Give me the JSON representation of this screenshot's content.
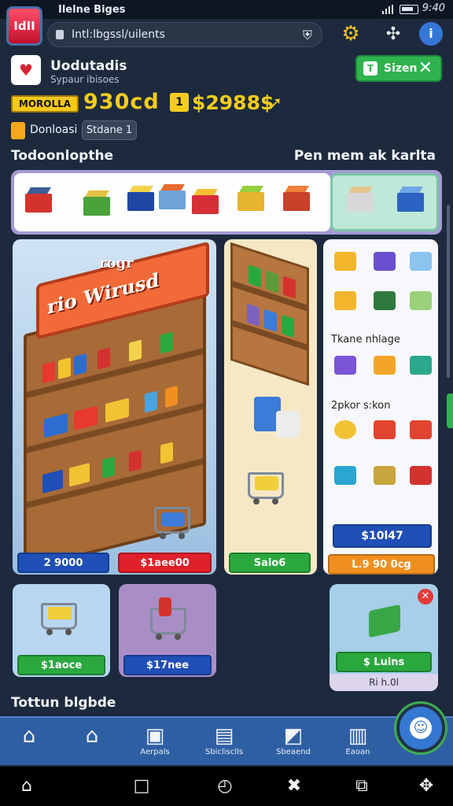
{
  "status": {
    "title": "Ilelne Biges",
    "time": "9:40"
  },
  "browser": {
    "url": "Intl:lbgssl/uilents"
  },
  "profile": {
    "name": "Uodutadis",
    "subtitle": "Sypaur ibisoes"
  },
  "header": {
    "action_label": "Sizen"
  },
  "currency": {
    "badge": "MOROLLA",
    "coins": "930cd",
    "gems": "$2988$",
    "cash_icon_label": "1"
  },
  "download": {
    "label": "Donloasi",
    "status": "Stdane 1"
  },
  "sections": {
    "featured_left": "Todoonlopthe",
    "featured_right": "Pen mem ak karlta",
    "bottom_title": "Tottun blgbde"
  },
  "store_panel": {
    "sign": "rio Wirusd",
    "sign_top": "rogr",
    "price_a": "2 9000",
    "price_b": "$1aee00"
  },
  "mid_panel": {
    "price": "Saio6"
  },
  "right_panel": {
    "label_1": "Tkane nhlage",
    "label_2": "2pkor s:kon",
    "price_main": "$10l47",
    "price_sub": "L.9 90 0cg"
  },
  "cards": [
    {
      "price": "$1aoce"
    },
    {
      "price": "$17nee"
    },
    {
      "price": "$ Luins",
      "footer": "Ri h.0l"
    }
  ],
  "bottom_nav": [
    {
      "label": "",
      "icon": "home-outline-icon"
    },
    {
      "label": "",
      "icon": "home-icon"
    },
    {
      "label": "Aerpals",
      "icon": "box-icon"
    },
    {
      "label": "Sbiclisclls",
      "icon": "register-icon"
    },
    {
      "label": "Sbeaend",
      "icon": "package-icon"
    },
    {
      "label": "Eaoan",
      "icon": "gate-icon"
    }
  ],
  "colors": {
    "accent_green": "#2fb34f",
    "accent_blue": "#1f4fb7",
    "accent_red": "#e0202b",
    "coin_yellow": "#f6cc1c",
    "bg": "#1d2a3e"
  }
}
